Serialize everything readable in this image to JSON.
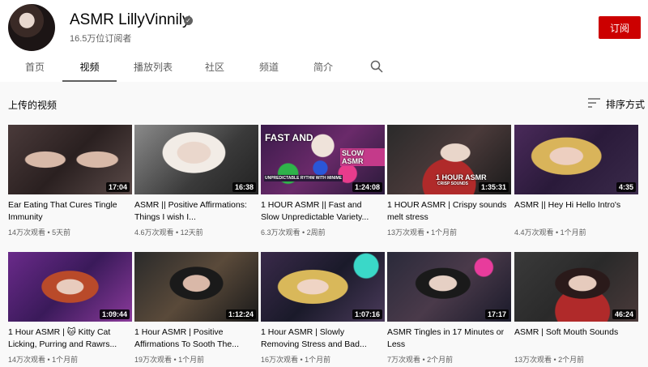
{
  "channel": {
    "name": "ASMR LillyVinnily",
    "subscribers": "16.5万位订阅者",
    "subscribe_label": "订阅"
  },
  "tabs": [
    {
      "label": "首页"
    },
    {
      "label": "视频",
      "active": true
    },
    {
      "label": "播放列表"
    },
    {
      "label": "社区"
    },
    {
      "label": "频道"
    },
    {
      "label": "简介"
    }
  ],
  "section": {
    "title": "上传的视频",
    "sort_label": "排序方式"
  },
  "videos": [
    {
      "title": "Ear Eating That Cures Tingle Immunity",
      "duration": "17:04",
      "views": "14万次观看",
      "age": "5天前"
    },
    {
      "title": "ASMR || Positive Affirmations: Things I wish I...",
      "duration": "16:38",
      "views": "4.6万次观看",
      "age": "12天前"
    },
    {
      "title": "1 HOUR ASMR || Fast and Slow Unpredictable Variety...",
      "duration": "1:24:08",
      "views": "6.3万次观看",
      "age": "2周前",
      "overlay1": "FAST AND",
      "overlay2": "SLOW ASMR",
      "overlay3": "UNPREDICTABLE RYTHM WITH MINIME"
    },
    {
      "title": "1 HOUR ASMR | Crispy sounds melt stress",
      "duration": "1:35:31",
      "views": "13万次观看",
      "age": "1个月前",
      "overlay1": "1 HOUR ASMR",
      "overlay2": "CRISP SOUNDS"
    },
    {
      "title": "ASMR || Hey Hi Hello Intro's",
      "duration": "4:35",
      "views": "4.4万次观看",
      "age": "1个月前"
    },
    {
      "title": "1 Hour ASMR | 🐱 Kitty Cat Licking, Purring and Rawrs...",
      "duration": "1:09:44",
      "views": "14万次观看",
      "age": "1个月前"
    },
    {
      "title": "1 Hour ASMR | Positive Affirmations To Sooth The...",
      "duration": "1:12:24",
      "views": "19万次观看",
      "age": "1个月前"
    },
    {
      "title": "1 Hour ASMR | Slowly Removing Stress and Bad...",
      "duration": "1:07:16",
      "views": "16万次观看",
      "age": "1个月前"
    },
    {
      "title": "ASMR Tingles in 17 Minutes or Less",
      "duration": "17:17",
      "views": "7万次观看",
      "age": "2个月前"
    },
    {
      "title": "ASMR | Soft Mouth Sounds",
      "duration": "46:24",
      "views": "13万次观看",
      "age": "2个月前"
    }
  ],
  "meta_separator": " • ",
  "icons": {
    "verified": "verified-check-icon",
    "search": "search-icon",
    "sort": "sort-lines-icon"
  }
}
